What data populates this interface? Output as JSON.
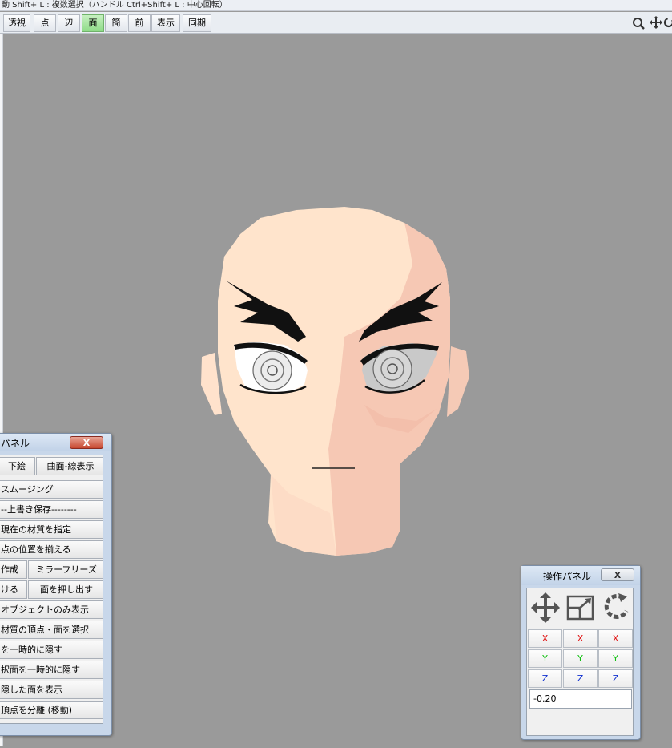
{
  "hint_bar": {
    "text": "動  Shift+ L : 複数選択（ハンドル  Ctrl+Shift+ L : 中心回転）"
  },
  "toolbar": {
    "buttons": [
      "透視",
      "点",
      "辺",
      "面",
      "簡",
      "前",
      "表示",
      "同期"
    ],
    "active": "面",
    "icons": [
      "zoom-icon",
      "pan-icon",
      "rotate-icon"
    ]
  },
  "command_panel": {
    "title": "パネル",
    "close": "X",
    "rows": [
      [
        "下絵",
        "曲面-線表示"
      ],
      [
        "スムージング"
      ],
      [
        "--上書き保存--------"
      ],
      [
        "現在の材質を指定"
      ],
      [
        "点の位置を揃える"
      ],
      [
        "作成",
        "ミラーフリーズ"
      ],
      [
        "ける",
        "面を押し出す"
      ],
      [
        "オブジェクトのみ表示"
      ],
      [
        "材質の頂点・面を選択"
      ],
      [
        "を一時的に隠す"
      ],
      [
        "択面を一時的に隠す"
      ],
      [
        "隠した面を表示"
      ],
      [
        "頂点を分離 (移動)"
      ]
    ]
  },
  "operation_panel": {
    "title": "操作パネル",
    "close": "X",
    "icons": [
      "move-icon",
      "scale-icon",
      "rotate-icon"
    ],
    "axes": [
      [
        "X",
        "X",
        "X"
      ],
      [
        "Y",
        "Y",
        "Y"
      ],
      [
        "Z",
        "Z",
        "Z"
      ]
    ],
    "value": "-0.20"
  },
  "colors": {
    "viewport_bg": "#9a9a9a",
    "skin_light": "#ffe4cc",
    "skin_shade": "#f6c8b4",
    "active_tab": "#8fdc88"
  }
}
